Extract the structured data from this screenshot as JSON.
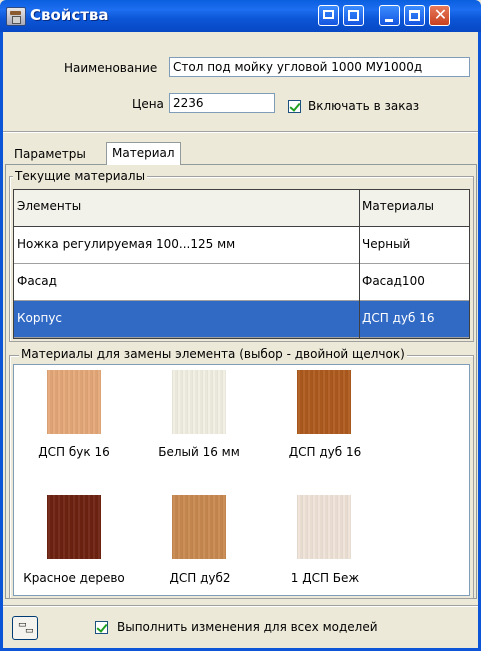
{
  "window": {
    "title": "Свойства"
  },
  "form": {
    "name_label": "Наименование",
    "name_value": "Стол под мойку угловой 1000 МУ1000д",
    "price_label": "Цена",
    "price_value": "2236",
    "include_checkbox": {
      "label": "Включать в заказ",
      "checked": true
    }
  },
  "tabs": [
    {
      "label": "Параметры",
      "active": false
    },
    {
      "label": "Материал",
      "active": true
    }
  ],
  "current_materials": {
    "title": "Текущие материалы",
    "columns": [
      "Элементы",
      "Материалы"
    ],
    "rows": [
      {
        "element": "Ножка регулируемая 100...125 мм",
        "material": "Черный",
        "selected": false
      },
      {
        "element": "Фасад",
        "material": "Фасад100",
        "selected": false
      },
      {
        "element": "Корпус",
        "material": "ДСП дуб 16",
        "selected": true
      }
    ]
  },
  "replacement_materials": {
    "title": "Материалы для замены элемента (выбор - двойной щелчок)",
    "items": [
      {
        "label": "ДСП бук 16",
        "color": "#e4a878"
      },
      {
        "label": "Белый 16 мм",
        "color": "#f1eee2"
      },
      {
        "label": "ДСП дуб 16",
        "color": "#ad5a1e"
      },
      {
        "label": "Красное дерево",
        "color": "#6d2210"
      },
      {
        "label": "ДСП дуб2",
        "color": "#c8894f"
      },
      {
        "label": "1 ДСП Беж",
        "color": "#efe3d8"
      }
    ]
  },
  "footer": {
    "apply_all_checkbox": {
      "label": "Выполнить изменения для всех моделей",
      "checked": true
    }
  }
}
